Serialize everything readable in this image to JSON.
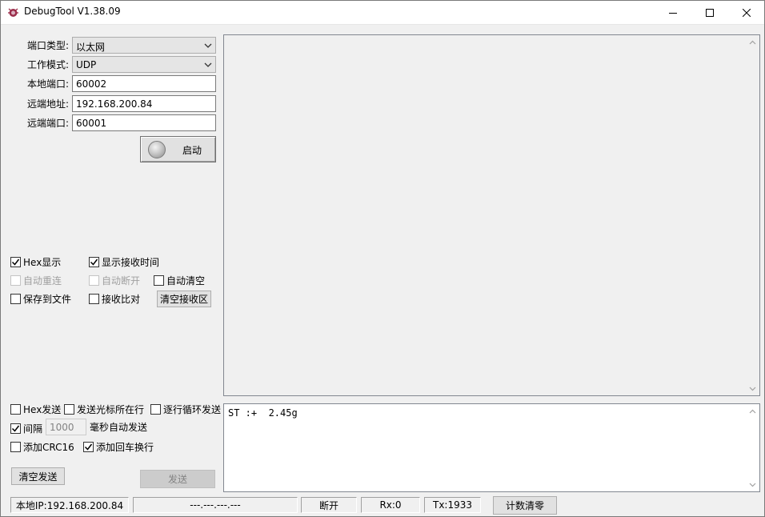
{
  "window": {
    "title": "DebugTool V1.38.09",
    "icon": "bug-icon"
  },
  "config": {
    "port_type_label": "端口类型:",
    "port_type_value": "以太网",
    "work_mode_label": "工作模式:",
    "work_mode_value": "UDP",
    "local_port_label": "本地端口:",
    "local_port_value": "60002",
    "remote_addr_label": "远端地址:",
    "remote_addr_value": "192.168.200.84",
    "remote_port_label": "远端端口:",
    "remote_port_value": "60001",
    "start_button": "启动"
  },
  "receive_options": {
    "hex_display": "Hex显示",
    "show_recv_time": "显示接收时间",
    "auto_reconnect": "自动重连",
    "auto_disconnect": "自动断开",
    "auto_clear": "自动清空",
    "save_to_file": "保存到文件",
    "recv_compare": "接收比对",
    "clear_recv_button": "清空接收区"
  },
  "send_options": {
    "hex_send": "Hex发送",
    "send_cursor_line": "发送光标所在行",
    "line_loop_send": "逐行循环发送",
    "interval": "间隔",
    "interval_value": "1000",
    "interval_unit": "毫秒自动发送",
    "add_crc16": "添加CRC16",
    "add_crlf": "添加回车换行",
    "clear_send_button": "清空发送",
    "send_button": "发送"
  },
  "send_area": {
    "text": "ST :+  2.45g"
  },
  "status_bar": {
    "local_ip": "本地IP:192.168.200.84",
    "remote": "---.---.---.---",
    "conn_state": "断开",
    "rx": "Rx:0",
    "tx": "Tx:1933",
    "reset_counter_button": "计数清零"
  }
}
